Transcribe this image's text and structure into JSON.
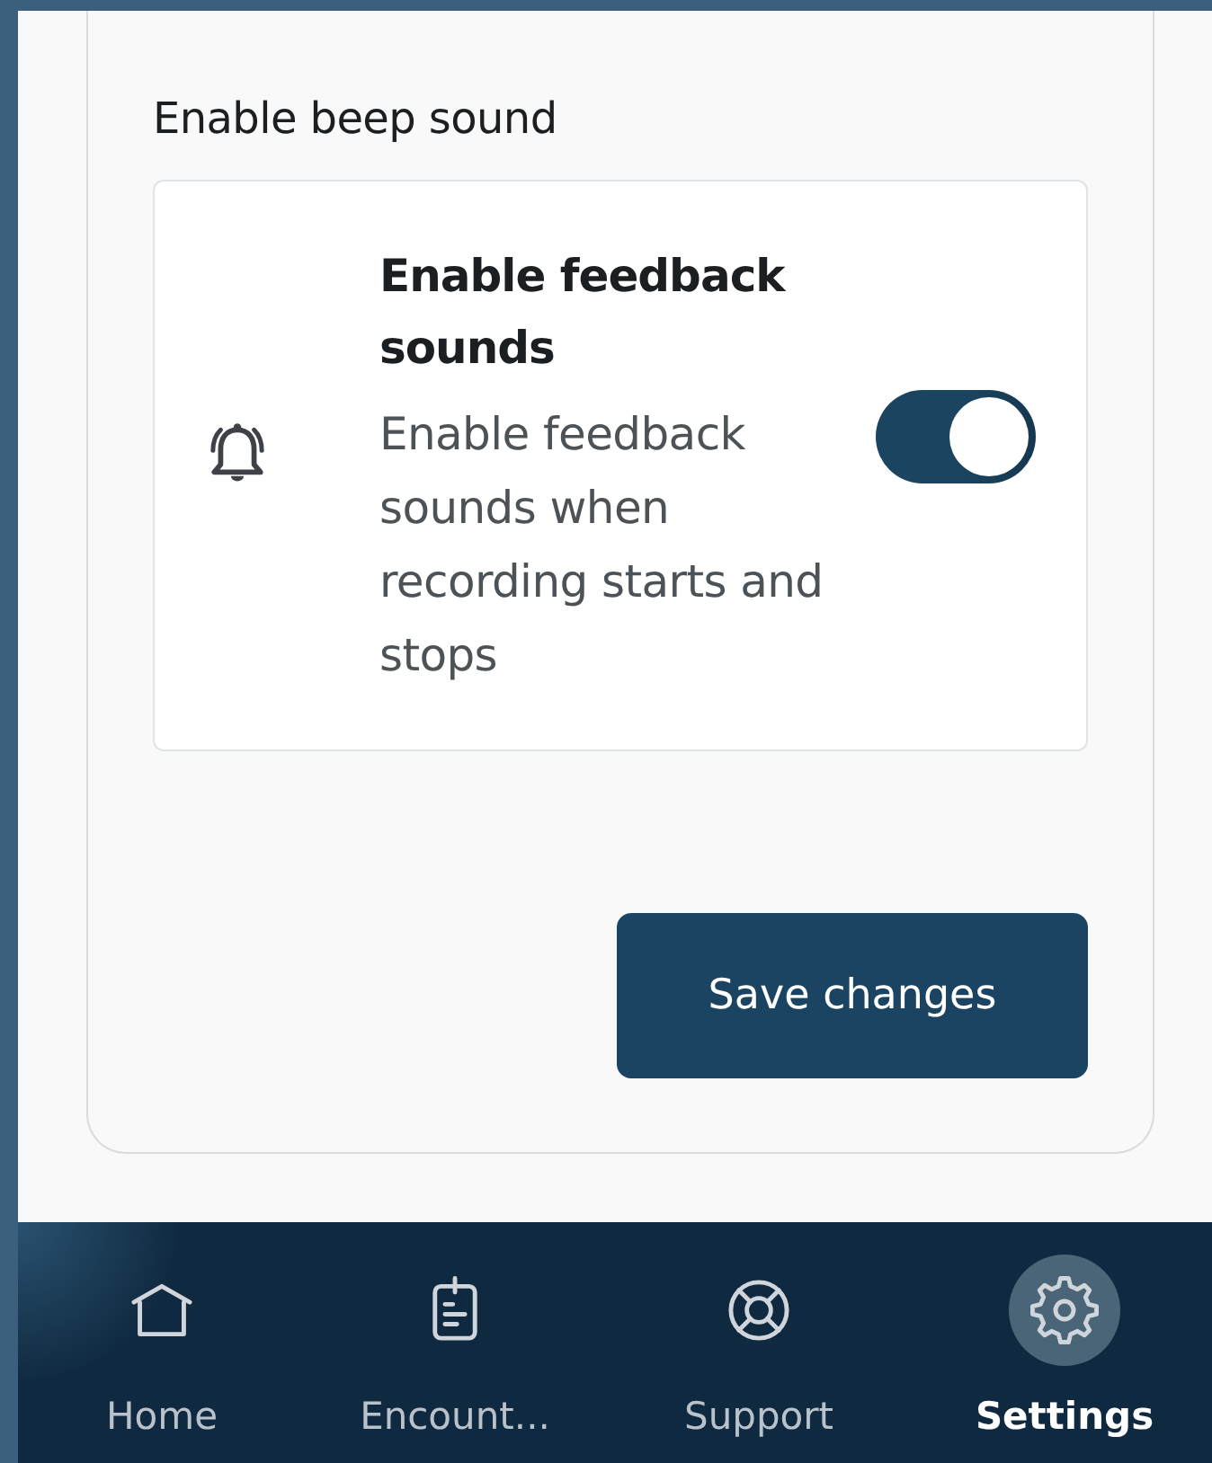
{
  "section": {
    "title": "Enable beep sound"
  },
  "setting": {
    "title": "Enable feedback sounds",
    "description": "Enable feedback sounds when recording starts and stops",
    "on": true
  },
  "save_button": {
    "label": "Save changes"
  },
  "nav": [
    {
      "kind": "home",
      "label": "Home",
      "selected": false
    },
    {
      "kind": "encounters",
      "label": "Encount...",
      "selected": false
    },
    {
      "kind": "support",
      "label": "Support",
      "selected": false
    },
    {
      "kind": "settings",
      "label": "Settings",
      "selected": true
    }
  ]
}
